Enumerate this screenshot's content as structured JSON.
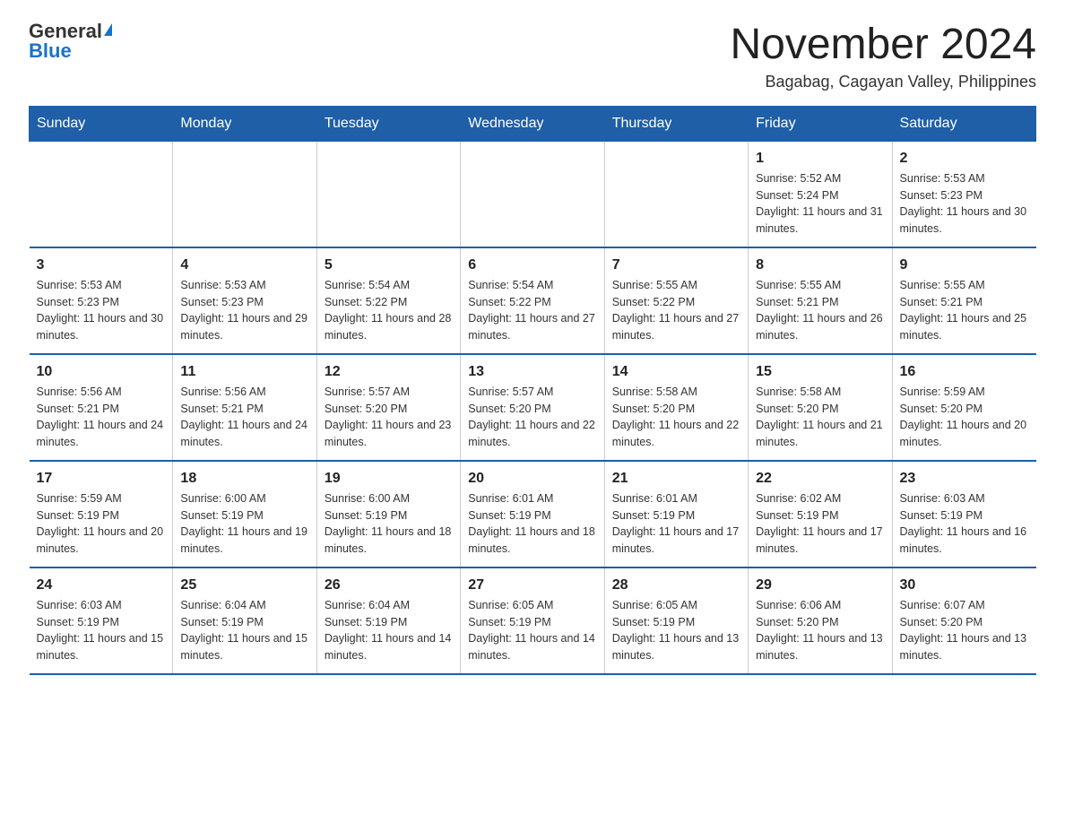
{
  "logo": {
    "general": "General",
    "blue": "Blue"
  },
  "title": "November 2024",
  "subtitle": "Bagabag, Cagayan Valley, Philippines",
  "days_of_week": [
    "Sunday",
    "Monday",
    "Tuesday",
    "Wednesday",
    "Thursday",
    "Friday",
    "Saturday"
  ],
  "weeks": [
    [
      {
        "day": "",
        "info": ""
      },
      {
        "day": "",
        "info": ""
      },
      {
        "day": "",
        "info": ""
      },
      {
        "day": "",
        "info": ""
      },
      {
        "day": "",
        "info": ""
      },
      {
        "day": "1",
        "info": "Sunrise: 5:52 AM\nSunset: 5:24 PM\nDaylight: 11 hours and 31 minutes."
      },
      {
        "day": "2",
        "info": "Sunrise: 5:53 AM\nSunset: 5:23 PM\nDaylight: 11 hours and 30 minutes."
      }
    ],
    [
      {
        "day": "3",
        "info": "Sunrise: 5:53 AM\nSunset: 5:23 PM\nDaylight: 11 hours and 30 minutes."
      },
      {
        "day": "4",
        "info": "Sunrise: 5:53 AM\nSunset: 5:23 PM\nDaylight: 11 hours and 29 minutes."
      },
      {
        "day": "5",
        "info": "Sunrise: 5:54 AM\nSunset: 5:22 PM\nDaylight: 11 hours and 28 minutes."
      },
      {
        "day": "6",
        "info": "Sunrise: 5:54 AM\nSunset: 5:22 PM\nDaylight: 11 hours and 27 minutes."
      },
      {
        "day": "7",
        "info": "Sunrise: 5:55 AM\nSunset: 5:22 PM\nDaylight: 11 hours and 27 minutes."
      },
      {
        "day": "8",
        "info": "Sunrise: 5:55 AM\nSunset: 5:21 PM\nDaylight: 11 hours and 26 minutes."
      },
      {
        "day": "9",
        "info": "Sunrise: 5:55 AM\nSunset: 5:21 PM\nDaylight: 11 hours and 25 minutes."
      }
    ],
    [
      {
        "day": "10",
        "info": "Sunrise: 5:56 AM\nSunset: 5:21 PM\nDaylight: 11 hours and 24 minutes."
      },
      {
        "day": "11",
        "info": "Sunrise: 5:56 AM\nSunset: 5:21 PM\nDaylight: 11 hours and 24 minutes."
      },
      {
        "day": "12",
        "info": "Sunrise: 5:57 AM\nSunset: 5:20 PM\nDaylight: 11 hours and 23 minutes."
      },
      {
        "day": "13",
        "info": "Sunrise: 5:57 AM\nSunset: 5:20 PM\nDaylight: 11 hours and 22 minutes."
      },
      {
        "day": "14",
        "info": "Sunrise: 5:58 AM\nSunset: 5:20 PM\nDaylight: 11 hours and 22 minutes."
      },
      {
        "day": "15",
        "info": "Sunrise: 5:58 AM\nSunset: 5:20 PM\nDaylight: 11 hours and 21 minutes."
      },
      {
        "day": "16",
        "info": "Sunrise: 5:59 AM\nSunset: 5:20 PM\nDaylight: 11 hours and 20 minutes."
      }
    ],
    [
      {
        "day": "17",
        "info": "Sunrise: 5:59 AM\nSunset: 5:19 PM\nDaylight: 11 hours and 20 minutes."
      },
      {
        "day": "18",
        "info": "Sunrise: 6:00 AM\nSunset: 5:19 PM\nDaylight: 11 hours and 19 minutes."
      },
      {
        "day": "19",
        "info": "Sunrise: 6:00 AM\nSunset: 5:19 PM\nDaylight: 11 hours and 18 minutes."
      },
      {
        "day": "20",
        "info": "Sunrise: 6:01 AM\nSunset: 5:19 PM\nDaylight: 11 hours and 18 minutes."
      },
      {
        "day": "21",
        "info": "Sunrise: 6:01 AM\nSunset: 5:19 PM\nDaylight: 11 hours and 17 minutes."
      },
      {
        "day": "22",
        "info": "Sunrise: 6:02 AM\nSunset: 5:19 PM\nDaylight: 11 hours and 17 minutes."
      },
      {
        "day": "23",
        "info": "Sunrise: 6:03 AM\nSunset: 5:19 PM\nDaylight: 11 hours and 16 minutes."
      }
    ],
    [
      {
        "day": "24",
        "info": "Sunrise: 6:03 AM\nSunset: 5:19 PM\nDaylight: 11 hours and 15 minutes."
      },
      {
        "day": "25",
        "info": "Sunrise: 6:04 AM\nSunset: 5:19 PM\nDaylight: 11 hours and 15 minutes."
      },
      {
        "day": "26",
        "info": "Sunrise: 6:04 AM\nSunset: 5:19 PM\nDaylight: 11 hours and 14 minutes."
      },
      {
        "day": "27",
        "info": "Sunrise: 6:05 AM\nSunset: 5:19 PM\nDaylight: 11 hours and 14 minutes."
      },
      {
        "day": "28",
        "info": "Sunrise: 6:05 AM\nSunset: 5:19 PM\nDaylight: 11 hours and 13 minutes."
      },
      {
        "day": "29",
        "info": "Sunrise: 6:06 AM\nSunset: 5:20 PM\nDaylight: 11 hours and 13 minutes."
      },
      {
        "day": "30",
        "info": "Sunrise: 6:07 AM\nSunset: 5:20 PM\nDaylight: 11 hours and 13 minutes."
      }
    ]
  ]
}
